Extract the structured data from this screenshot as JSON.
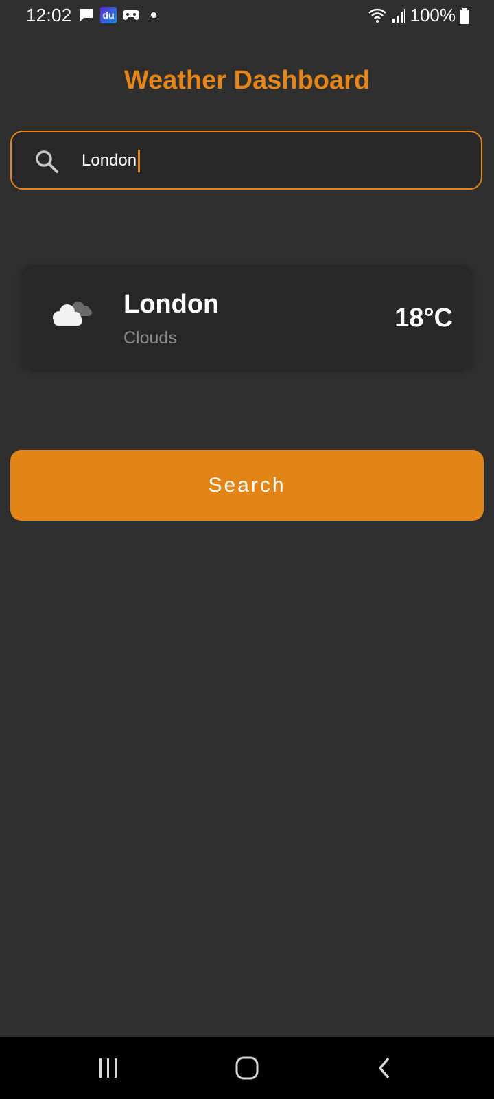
{
  "status_bar": {
    "time": "12:02",
    "du_label": "du",
    "battery": "100%"
  },
  "header": {
    "title": "Weather Dashboard"
  },
  "search": {
    "value": "London"
  },
  "weather": {
    "city": "London",
    "condition": "Clouds",
    "temperature": "18°C",
    "icon": "cloud-icon"
  },
  "actions": {
    "search_label": "Search"
  },
  "colors": {
    "accent": "#e5861a",
    "background": "#2f2f2f",
    "card": "#282828"
  }
}
